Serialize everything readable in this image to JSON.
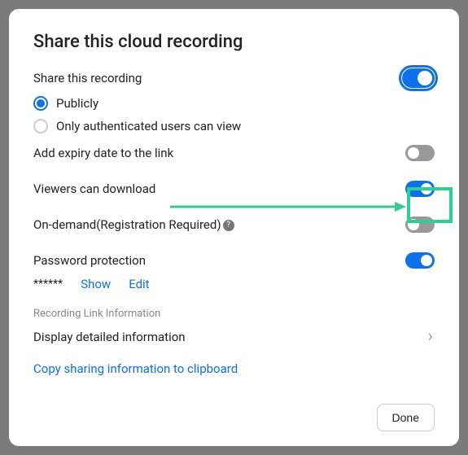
{
  "title": "Share this cloud recording",
  "shareRecording": {
    "label": "Share this recording",
    "toggle": true
  },
  "radio": {
    "publicly": "Publicly",
    "authenticated": "Only authenticated users can view",
    "selected": "publicly"
  },
  "expiry": {
    "label": "Add expiry date to the link",
    "toggle": false
  },
  "download": {
    "label": "Viewers can download",
    "toggle": true,
    "highlighted": true
  },
  "onDemand": {
    "label": "On-demand(Registration Required)",
    "toggle": false
  },
  "password": {
    "label": "Password protection",
    "toggle": true,
    "mask": "******",
    "showLabel": "Show",
    "editLabel": "Edit"
  },
  "linkInfo": {
    "sectionLabel": "Recording Link Information",
    "detailLabel": "Display detailed information",
    "copyLabel": "Copy sharing information to clipboard"
  },
  "doneLabel": "Done"
}
